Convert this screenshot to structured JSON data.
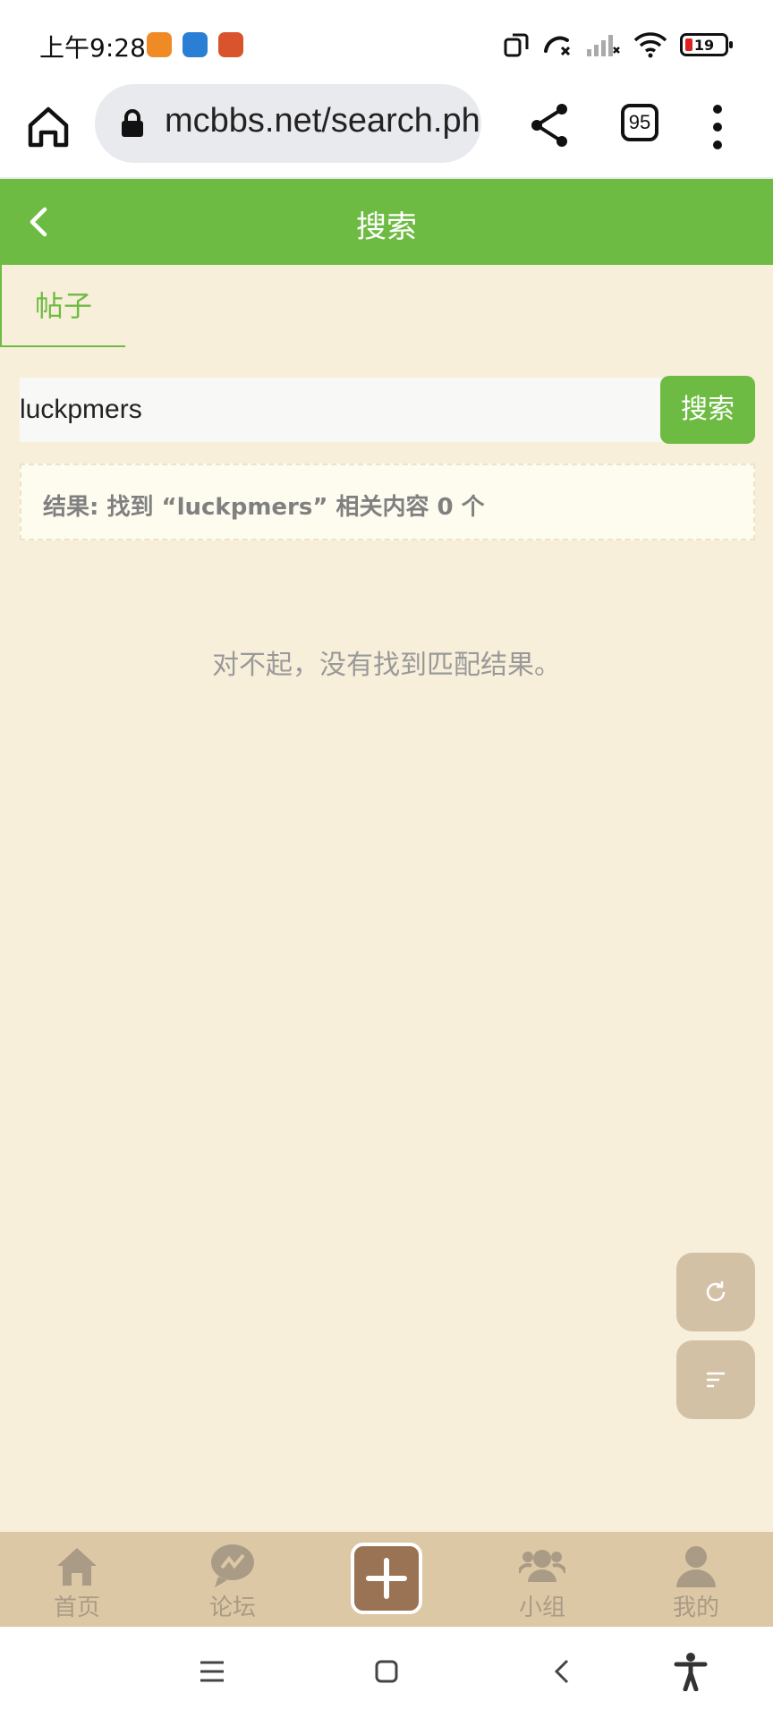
{
  "status_bar": {
    "time": "上午9:28",
    "battery": "19"
  },
  "browser": {
    "url": "mcbbs.net/search.ph",
    "tab_count": "95"
  },
  "header": {
    "title": "搜索"
  },
  "tabs": [
    {
      "label": "帖子",
      "active": true
    }
  ],
  "search": {
    "query": "luckpmers",
    "button_label": "搜索"
  },
  "result": {
    "summary": "结果: 找到 “luckpmers” 相关内容 0 个",
    "empty_message": "对不起，没有找到匹配结果。"
  },
  "bottom_nav": {
    "items": [
      {
        "label": "首页",
        "icon": "home-icon"
      },
      {
        "label": "论坛",
        "icon": "forum-icon"
      },
      {
        "label": "",
        "icon": "plus-icon"
      },
      {
        "label": "小组",
        "icon": "group-icon"
      },
      {
        "label": "我的",
        "icon": "user-icon"
      }
    ]
  },
  "colors": {
    "accent": "#6dbb43",
    "background": "#f8efda",
    "nav_background": "#ddc8a5",
    "post_button": "#9a7354"
  }
}
